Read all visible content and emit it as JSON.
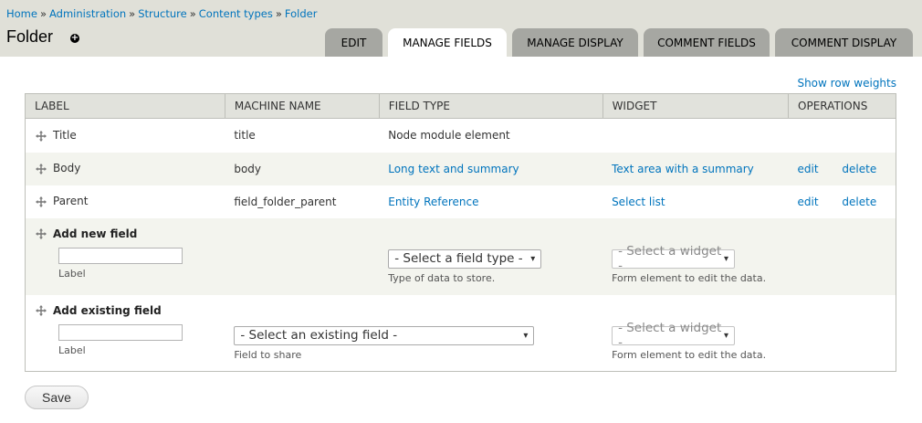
{
  "breadcrumb": [
    "Home",
    "Administration",
    "Structure",
    "Content types",
    "Folder"
  ],
  "breadcrumb_separator": "»",
  "page_title": "Folder",
  "add_shortcut_icon": "+",
  "tabs": [
    {
      "label": "Edit",
      "active": false
    },
    {
      "label": "Manage fields",
      "active": true
    },
    {
      "label": "Manage display",
      "active": false
    },
    {
      "label": "Comment fields",
      "active": false
    },
    {
      "label": "Comment display",
      "active": false
    }
  ],
  "show_row_weights": "Show row weights",
  "table": {
    "headers": [
      "Label",
      "Machine name",
      "Field type",
      "Widget",
      "Operations"
    ],
    "rows": [
      {
        "label": "Title",
        "machine_name": "title",
        "field_type": "Node module element",
        "widget": "",
        "edit": "",
        "delete": ""
      },
      {
        "label": "Body",
        "machine_name": "body",
        "field_type": "Long text and summary",
        "widget": "Text area with a summary",
        "edit": "edit",
        "delete": "delete"
      },
      {
        "label": "Parent",
        "machine_name": "field_folder_parent",
        "field_type": "Entity Reference",
        "widget": "Select list",
        "edit": "edit",
        "delete": "delete"
      }
    ],
    "add_new": {
      "title": "Add new field",
      "label_value": "",
      "label_desc": "Label",
      "field_type_select": "- Select a field type -",
      "field_type_desc": "Type of data to store.",
      "widget_select": "- Select a widget -",
      "widget_desc": "Form element to edit the data."
    },
    "add_existing": {
      "title": "Add existing field",
      "label_value": "",
      "label_desc": "Label",
      "existing_select": "- Select an existing field -",
      "existing_desc": "Field to share",
      "widget_select": "- Select a widget -",
      "widget_desc": "Form element to edit the data."
    }
  },
  "save_label": "Save",
  "colors": {
    "link": "#0074bd",
    "header_bg": "#e0e0d8",
    "tab_bg": "#a6a7a2",
    "row_alt": "#f3f4ee"
  }
}
